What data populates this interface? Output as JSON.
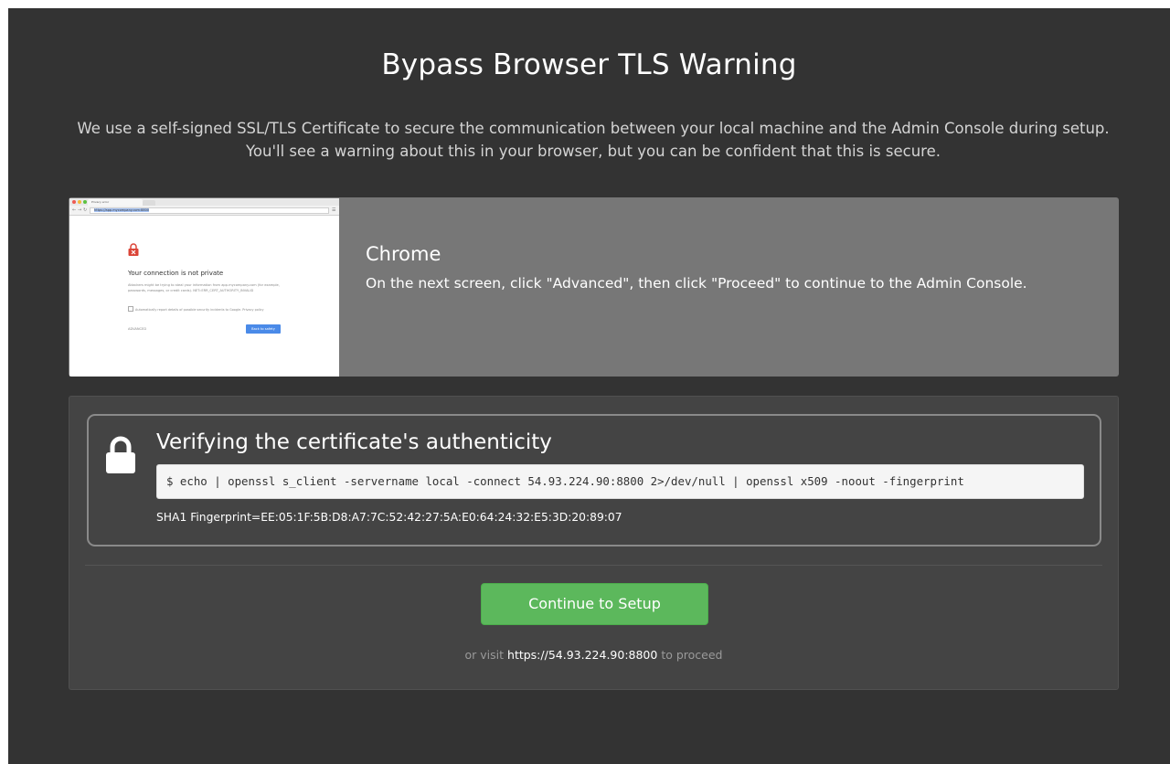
{
  "page": {
    "title": "Bypass Browser TLS Warning",
    "intro": "We use a self-signed SSL/TLS Certificate to secure the communication between your local machine and the Admin Console during setup. You'll see a warning about this in your browser, but you can be confident that this is secure."
  },
  "browser_card": {
    "name": "Chrome",
    "instructions": "On the next screen, click \"Advanced\", then click \"Proceed\" to continue to the Admin Console.",
    "screenshot": {
      "tab_label": "Privacy error",
      "url": "https://app.mycompany.com:8800",
      "heading": "Your connection is not private",
      "body": "Attackers might be trying to steal your information from app.mycompany.com (for example, passwords, messages, or credit cards). NET::ERR_CERT_AUTHORITY_INVALID",
      "checkbox_text": "Automatically report details of possible security incidents to Google. Privacy policy",
      "advanced_label": "ADVANCED",
      "back_button": "Back to safety"
    }
  },
  "verify": {
    "title": "Verifying the certificate's authenticity",
    "command": "$ echo | openssl s_client -servername local -connect 54.93.224.90:8800 2>/dev/null | openssl x509 -noout -fingerprint",
    "fingerprint": "SHA1 Fingerprint=EE:05:1F:5B:D8:A7:7C:52:42:27:5A:E0:64:24:32:E5:3D:20:89:07",
    "icon": "lock-icon"
  },
  "actions": {
    "continue_label": "Continue to Setup",
    "visit_prefix": "or visit",
    "visit_url": "https://54.93.224.90:8800",
    "visit_suffix": "to proceed"
  },
  "colors": {
    "background": "#333333",
    "chrome_card": "#777777",
    "verify_panel": "#444444",
    "continue_button": "#5cb85c"
  }
}
